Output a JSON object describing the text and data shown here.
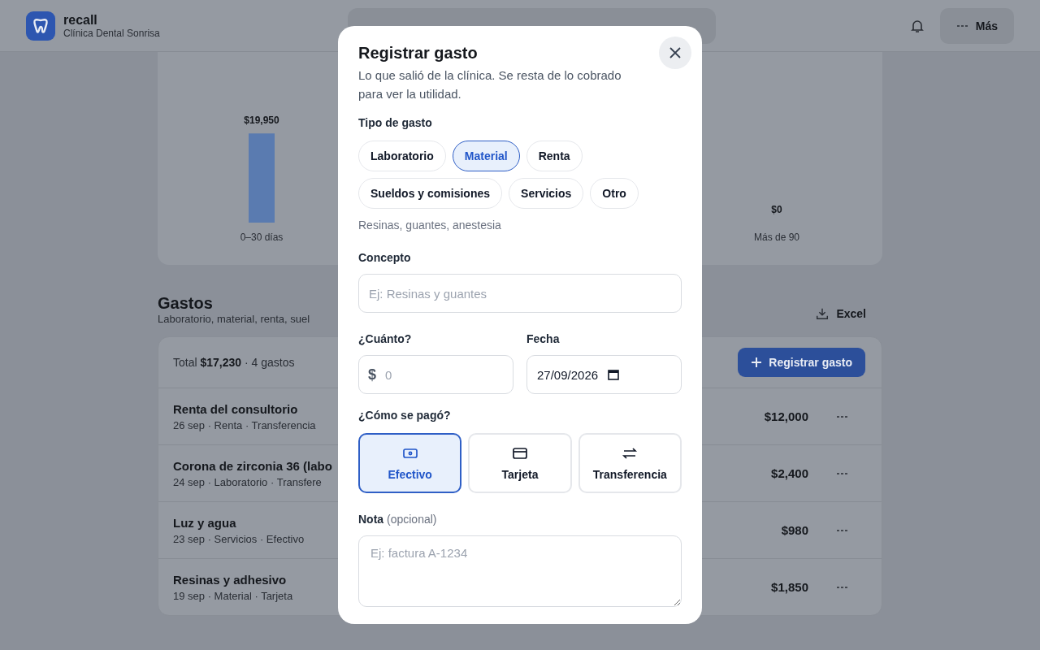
{
  "app": {
    "name": "recall",
    "clinic": "Clínica Dental Sonrisa"
  },
  "more_button": "Más",
  "aging_chart": {
    "chart_data": {
      "type": "bar",
      "categories": [
        "0–30 días",
        "Más de 90"
      ],
      "values": [
        19950,
        0
      ],
      "value_labels": [
        "$19,950",
        "$0"
      ]
    }
  },
  "expenses": {
    "title": "Gastos",
    "subtitle": "Laboratorio, material, renta, suel",
    "export": "Excel",
    "total_label": "Total",
    "total": "$17,230",
    "count": "· 4 gastos",
    "add_button": "Registrar gasto",
    "rows": [
      {
        "concept": "Renta del consultorio",
        "meta": "26 sep · Renta · Transferencia",
        "amount": "$12,000"
      },
      {
        "concept": "Corona de zirconia 36 (labo",
        "meta": "24 sep · Laboratorio · Transfere",
        "amount": "$2,400"
      },
      {
        "concept": "Luz y agua",
        "meta": "23 sep · Servicios · Efectivo",
        "amount": "$980"
      },
      {
        "concept": "Resinas y adhesivo",
        "meta": "19 sep · Material · Tarjeta",
        "amount": "$1,850"
      }
    ]
  },
  "modal": {
    "title": "Registrar gasto",
    "subtitle": "Lo que salió de la clínica. Se resta de lo cobrado para ver la utilidad.",
    "type_label": "Tipo de gasto",
    "types": [
      {
        "label": "Laboratorio",
        "selected": false
      },
      {
        "label": "Material",
        "selected": true
      },
      {
        "label": "Renta",
        "selected": false
      },
      {
        "label": "Sueldos y comisiones",
        "selected": false
      },
      {
        "label": "Servicios",
        "selected": false
      },
      {
        "label": "Otro",
        "selected": false
      }
    ],
    "type_hint": "Resinas, guantes, anestesia",
    "concept_label": "Concepto",
    "concept_placeholder": "Ej: Resinas y guantes",
    "amount_label": "¿Cuánto?",
    "currency": "$",
    "amount_placeholder": "0",
    "date_label": "Fecha",
    "date": "27/09/2026",
    "payment_label": "¿Cómo se pagó?",
    "payments": [
      {
        "label": "Efectivo",
        "selected": true
      },
      {
        "label": "Tarjeta",
        "selected": false
      },
      {
        "label": "Transferencia",
        "selected": false
      }
    ],
    "note_label": "Nota",
    "note_optional": "(opcional)",
    "note_placeholder": "Ej: factura A-1234"
  }
}
